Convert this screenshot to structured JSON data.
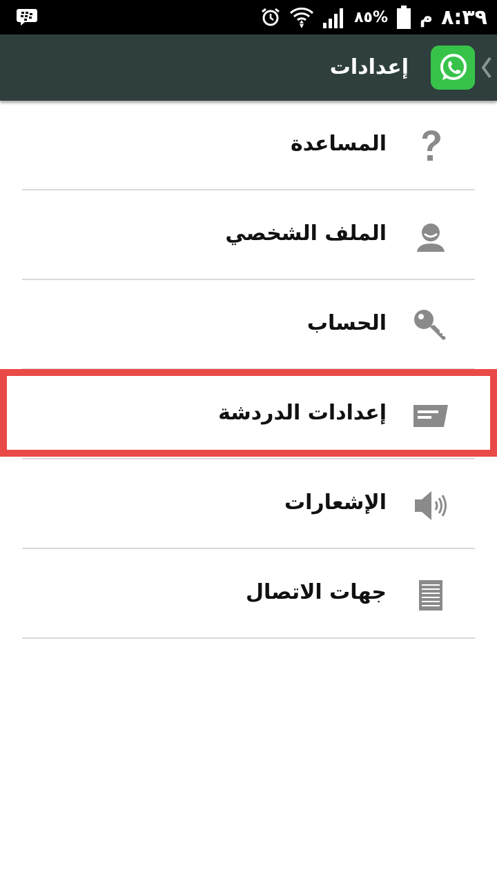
{
  "status_bar": {
    "time": "٨:٣٩",
    "ampm": "م",
    "battery": "٨٥%"
  },
  "app_bar": {
    "title": "إعدادات"
  },
  "settings": [
    {
      "label": "المساعدة",
      "icon": "help-question-icon"
    },
    {
      "label": "الملف الشخصي",
      "icon": "profile-person-icon"
    },
    {
      "label": "الحساب",
      "icon": "key-icon"
    },
    {
      "label": "إعدادات الدردشة",
      "icon": "chat-message-icon",
      "highlighted": true
    },
    {
      "label": "الإشعارات",
      "icon": "speaker-sound-icon"
    },
    {
      "label": "جهات الاتصال",
      "icon": "contacts-list-icon"
    }
  ],
  "colors": {
    "app_bar": "#2f3f3e",
    "whatsapp_green": "#37c34a",
    "highlight_border": "#e94a47",
    "icon_gray": "#8a8a8a",
    "divider": "#d9d9d9"
  }
}
